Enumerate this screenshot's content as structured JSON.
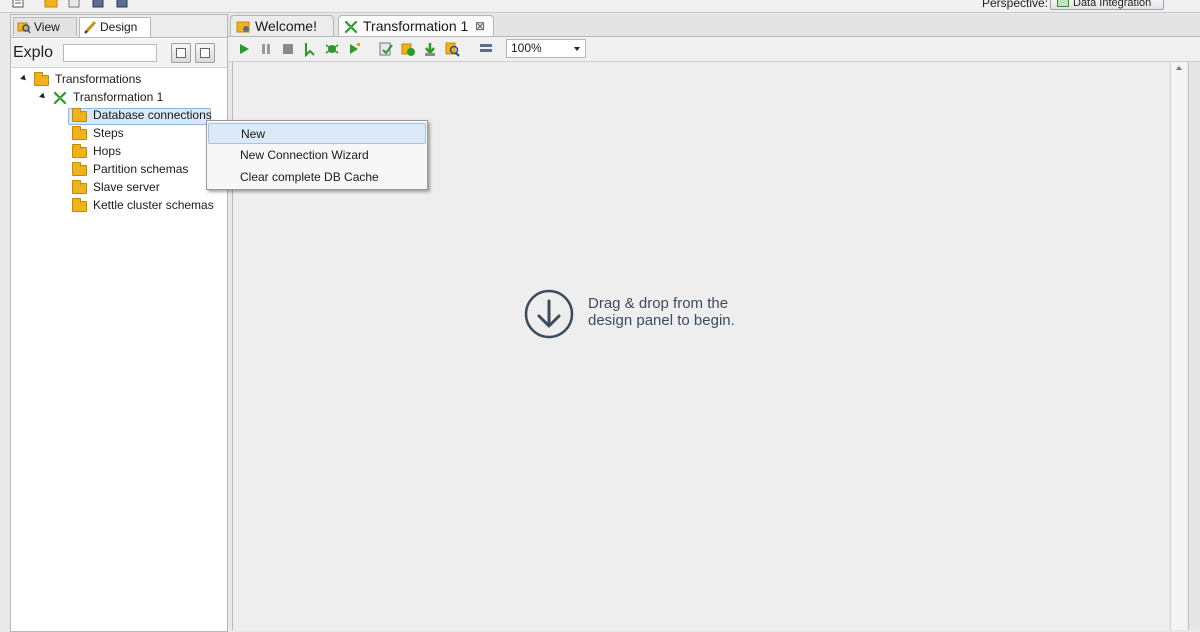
{
  "topbar": {
    "perspective_label": "Perspective:",
    "perspective_value": "Data Integration"
  },
  "left_panel": {
    "tabs": [
      {
        "label": "View",
        "icon": "view-icon"
      },
      {
        "label": "Design",
        "icon": "pencil-icon"
      }
    ],
    "explorer_label": "Explo",
    "search_value": "",
    "tree": {
      "root": "Transformations",
      "transformation": "Transformation 1",
      "children": [
        "Database connections",
        "Steps",
        "Hops",
        "Partition schemas",
        "Slave server",
        "Kettle cluster schemas"
      ],
      "selected": "Database connections"
    }
  },
  "editor": {
    "tabs": [
      {
        "label": "Welcome!",
        "icon": "welcome-icon",
        "active": false
      },
      {
        "label": "Transformation 1",
        "icon": "transformation-icon",
        "active": true
      }
    ],
    "zoom": "100%",
    "hint_line1": "Drag & drop from the",
    "hint_line2": "design panel to begin."
  },
  "context_menu": {
    "items": [
      "New",
      "New Connection Wizard",
      "Clear complete DB Cache"
    ],
    "highlighted": "New"
  },
  "colors": {
    "folder": "#f0b21a",
    "selection": "#d8e8f7",
    "run_green": "#2a9a2a",
    "hint_text": "#3c4c5c"
  }
}
